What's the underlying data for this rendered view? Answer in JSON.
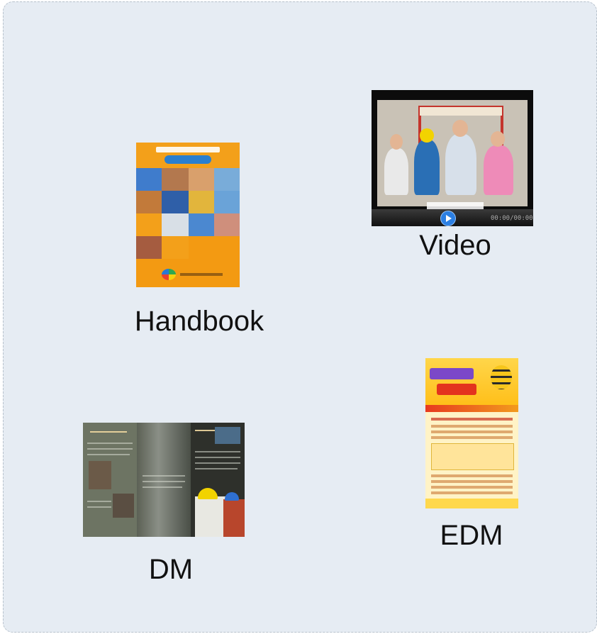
{
  "items": [
    {
      "id": "handbook",
      "label": "Handbook"
    },
    {
      "id": "video",
      "label": "Video"
    },
    {
      "id": "dm",
      "label": "DM"
    },
    {
      "id": "edm",
      "label": "EDM"
    }
  ],
  "video": {
    "time": "00:00/00:00"
  },
  "colors": {
    "panel_bg": "#e6ecf3",
    "handbook_orange": "#f39a12",
    "video_play_blue": "#2b7fe3",
    "edm_yellow": "#ffd64a"
  },
  "icons": [
    "play-icon",
    "taipei-logo-icon",
    "bee-mascot-icon"
  ]
}
